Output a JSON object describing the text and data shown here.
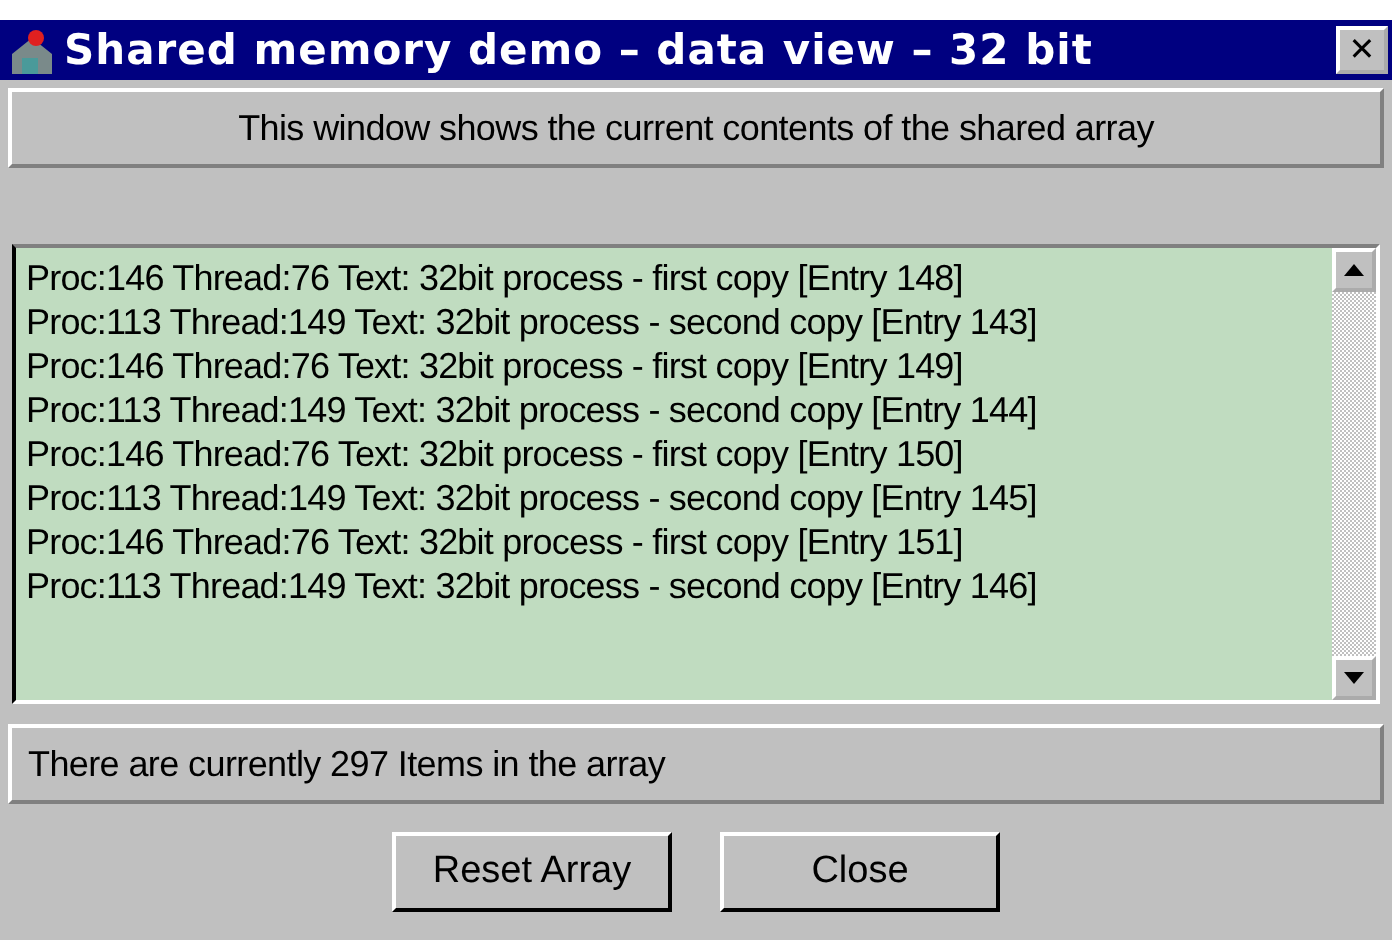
{
  "window": {
    "title": "Shared memory demo – data view – 32 bit",
    "close": "✕"
  },
  "header": {
    "text": "This window shows the current contents of the shared array"
  },
  "list": {
    "items": [
      "Proc:146 Thread:76 Text: 32bit process - first copy [Entry 148]",
      "Proc:113 Thread:149 Text: 32bit process - second copy [Entry 143]",
      "Proc:146 Thread:76 Text: 32bit process - first copy [Entry 149]",
      "Proc:113 Thread:149 Text: 32bit process - second copy [Entry 144]",
      "Proc:146 Thread:76 Text: 32bit process - first copy [Entry 150]",
      "Proc:113 Thread:149 Text: 32bit process - second copy [Entry 145]",
      "Proc:146 Thread:76 Text: 32bit process - first copy [Entry 151]",
      "Proc:113 Thread:149 Text: 32bit process - second copy [Entry 146]"
    ]
  },
  "status": {
    "text": "There are currently 297 Items in the array"
  },
  "buttons": [
    "Reset Array",
    "Close"
  ]
}
